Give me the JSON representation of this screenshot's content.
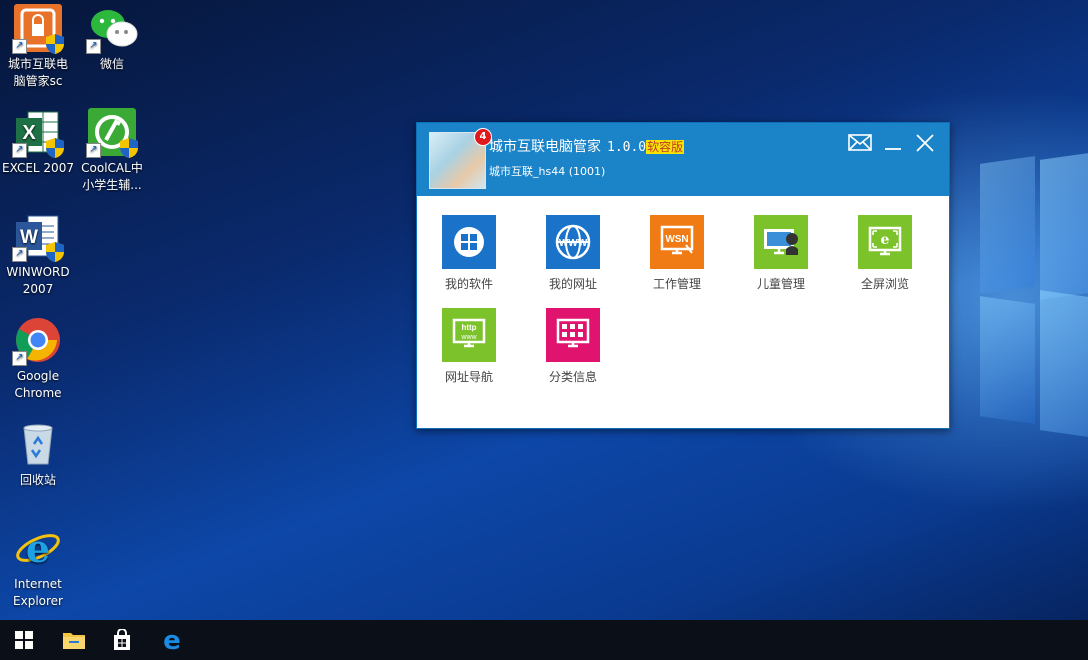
{
  "desktop": {
    "icons": [
      {
        "label": "城市互联电\n脑管家sc",
        "icon": "city-manager-icon",
        "color": "#e9722b"
      },
      {
        "label": "微信",
        "icon": "wechat-icon",
        "color": "#2bb83d"
      },
      {
        "label": "EXCEL 2007",
        "icon": "excel-icon",
        "color": "#1e7145"
      },
      {
        "label": "CoolCAL中\n小学生辅...",
        "icon": "coolcal-icon",
        "color": "#3aa935"
      },
      {
        "label": "WINWORD\n2007",
        "icon": "word-icon",
        "color": "#2b579a"
      },
      {
        "label": "Google\nChrome",
        "icon": "chrome-icon",
        "color": "#db4437"
      },
      {
        "label": "回收站",
        "icon": "recycle-bin-icon",
        "color": "#9fb6c8"
      },
      {
        "label": "Internet\nExplorer",
        "icon": "ie-icon",
        "color": "#1ea1e3"
      }
    ]
  },
  "app": {
    "title": "城市互联电脑管家",
    "version": "1.0.0",
    "edition": "软容版",
    "subtitle": "城市互联_hs44 (1001)",
    "badge": "4",
    "header_color": "#1b84c9",
    "tiles": [
      {
        "label": "我的软件",
        "icon": "my-software-icon",
        "color": "#1a73c9"
      },
      {
        "label": "我的网址",
        "icon": "my-websites-icon",
        "color": "#1a73c9"
      },
      {
        "label": "工作管理",
        "icon": "work-management-icon",
        "color": "#f07a14"
      },
      {
        "label": "儿童管理",
        "icon": "child-management-icon",
        "color": "#7cc22b"
      },
      {
        "label": "全屏浏览",
        "icon": "fullscreen-browse-icon",
        "color": "#7cc22b"
      },
      {
        "label": "网址导航",
        "icon": "url-navigation-icon",
        "color": "#7cc22b"
      },
      {
        "label": "分类信息",
        "icon": "classified-info-icon",
        "color": "#e0136f"
      }
    ]
  }
}
